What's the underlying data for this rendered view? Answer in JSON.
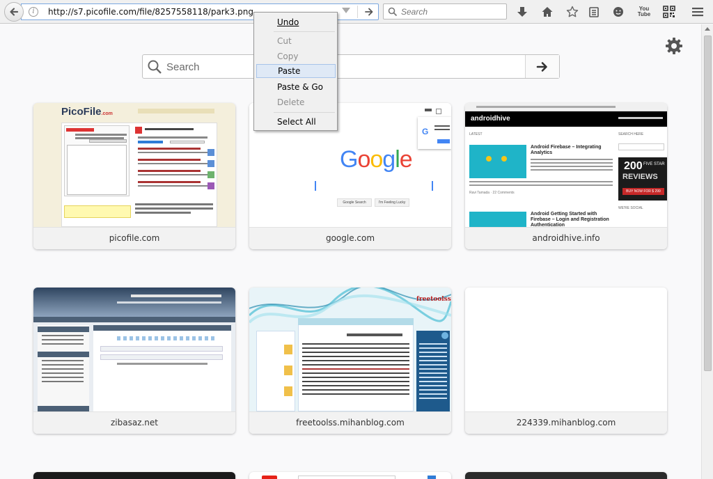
{
  "browser": {
    "url": "http://s7.picofile.com/file/8257558118/park3.png",
    "search_placeholder": "Search",
    "youtube_icon_text": "You Tube"
  },
  "newtab": {
    "search_placeholder": "Search",
    "tiles": [
      {
        "label": "picofile.com"
      },
      {
        "label": "google.com"
      },
      {
        "label": "androidhive.info"
      },
      {
        "label": "zibasaz.net"
      },
      {
        "label": "freetoolss.mihanblog.com"
      },
      {
        "label": "224339.mihanblog.com"
      }
    ]
  },
  "context_menu": {
    "items": [
      "Undo",
      "Cut",
      "Copy",
      "Paste",
      "Paste & Go",
      "Delete",
      "Select All"
    ]
  },
  "thumb_text": {
    "picofile_logo": "PicoFile",
    "picofile_logo_suffix": ".com",
    "google_logo": "Google",
    "google_search_btn": "Google Search",
    "google_lucky_btn": "I'm Feeling Lucky",
    "androidhive_brand": "androidhive",
    "androidhive_latest": "LATEST",
    "androidhive_searchhere": "SEARCH HERE",
    "androidhive_post1": "Android Firebase – Integrating Analytics",
    "androidhive_post2": "Android Getting Started with Firebase – Login and Registration Authentication",
    "androidhive_author": "Ravi Tamada",
    "androidhive_comments": "22 Comments",
    "androidhive_ad_num": "200",
    "androidhive_ad_five": "FIVE STAR",
    "androidhive_ad_reviews": "REVIEWS",
    "androidhive_ad_buy": "BUY NOW FOR $ 299",
    "androidhive_weresocial": "WE'RE SOCIAL",
    "freetoolss_brand": "freetoolss"
  },
  "colors": {
    "accent_blue": "#2f7cd6",
    "ad_red": "#c62828",
    "teal": "#1fb4c8"
  }
}
